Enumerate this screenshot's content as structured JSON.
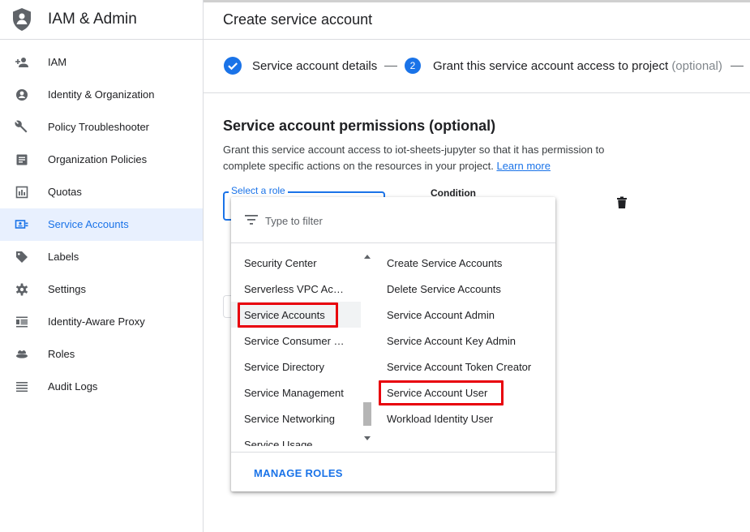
{
  "sidebar": {
    "title": "IAM & Admin",
    "items": [
      {
        "label": "IAM",
        "icon": "person-add-icon"
      },
      {
        "label": "Identity & Organization",
        "icon": "account-circle-icon"
      },
      {
        "label": "Policy Troubleshooter",
        "icon": "wrench-icon"
      },
      {
        "label": "Organization Policies",
        "icon": "document-icon"
      },
      {
        "label": "Quotas",
        "icon": "quotas-icon"
      },
      {
        "label": "Service Accounts",
        "icon": "service-account-icon",
        "active": true
      },
      {
        "label": "Labels",
        "icon": "label-icon"
      },
      {
        "label": "Settings",
        "icon": "gear-icon"
      },
      {
        "label": "Identity-Aware Proxy",
        "icon": "proxy-icon"
      },
      {
        "label": "Roles",
        "icon": "roles-icon"
      },
      {
        "label": "Audit Logs",
        "icon": "list-icon"
      }
    ]
  },
  "header": {
    "title": "Create service account"
  },
  "stepper": {
    "step1_label": "Service account details",
    "step2_number": "2",
    "step2_label": "Grant this service account access to project",
    "step2_optional": "(optional)"
  },
  "permissions": {
    "title": "Service account permissions (optional)",
    "description": "Grant this service account access to iot-sheets-jupyter so that it has permission to complete specific actions on the resources in your project.",
    "learn_more": "Learn more",
    "role_label": "Select a role",
    "condition_label": "Condition"
  },
  "dropdown": {
    "filter_placeholder": "Type to filter",
    "services": [
      {
        "label": "Security Center"
      },
      {
        "label": "Serverless VPC Access"
      },
      {
        "label": "Service Accounts",
        "highlighted": true
      },
      {
        "label": "Service Consumer Management"
      },
      {
        "label": "Service Directory"
      },
      {
        "label": "Service Management"
      },
      {
        "label": "Service Networking"
      },
      {
        "label": "Service Usage"
      }
    ],
    "roles": [
      {
        "label": "Create Service Accounts"
      },
      {
        "label": "Delete Service Accounts"
      },
      {
        "label": "Service Account Admin"
      },
      {
        "label": "Service Account Key Admin"
      },
      {
        "label": "Service Account Token Creator"
      },
      {
        "label": "Service Account User",
        "highlighted": true
      },
      {
        "label": "Workload Identity User"
      }
    ],
    "manage_roles": "MANAGE ROLES"
  },
  "colors": {
    "accent": "#1a73e8",
    "highlight_box": "#e8000c",
    "active_bg": "#e8f0fe"
  }
}
